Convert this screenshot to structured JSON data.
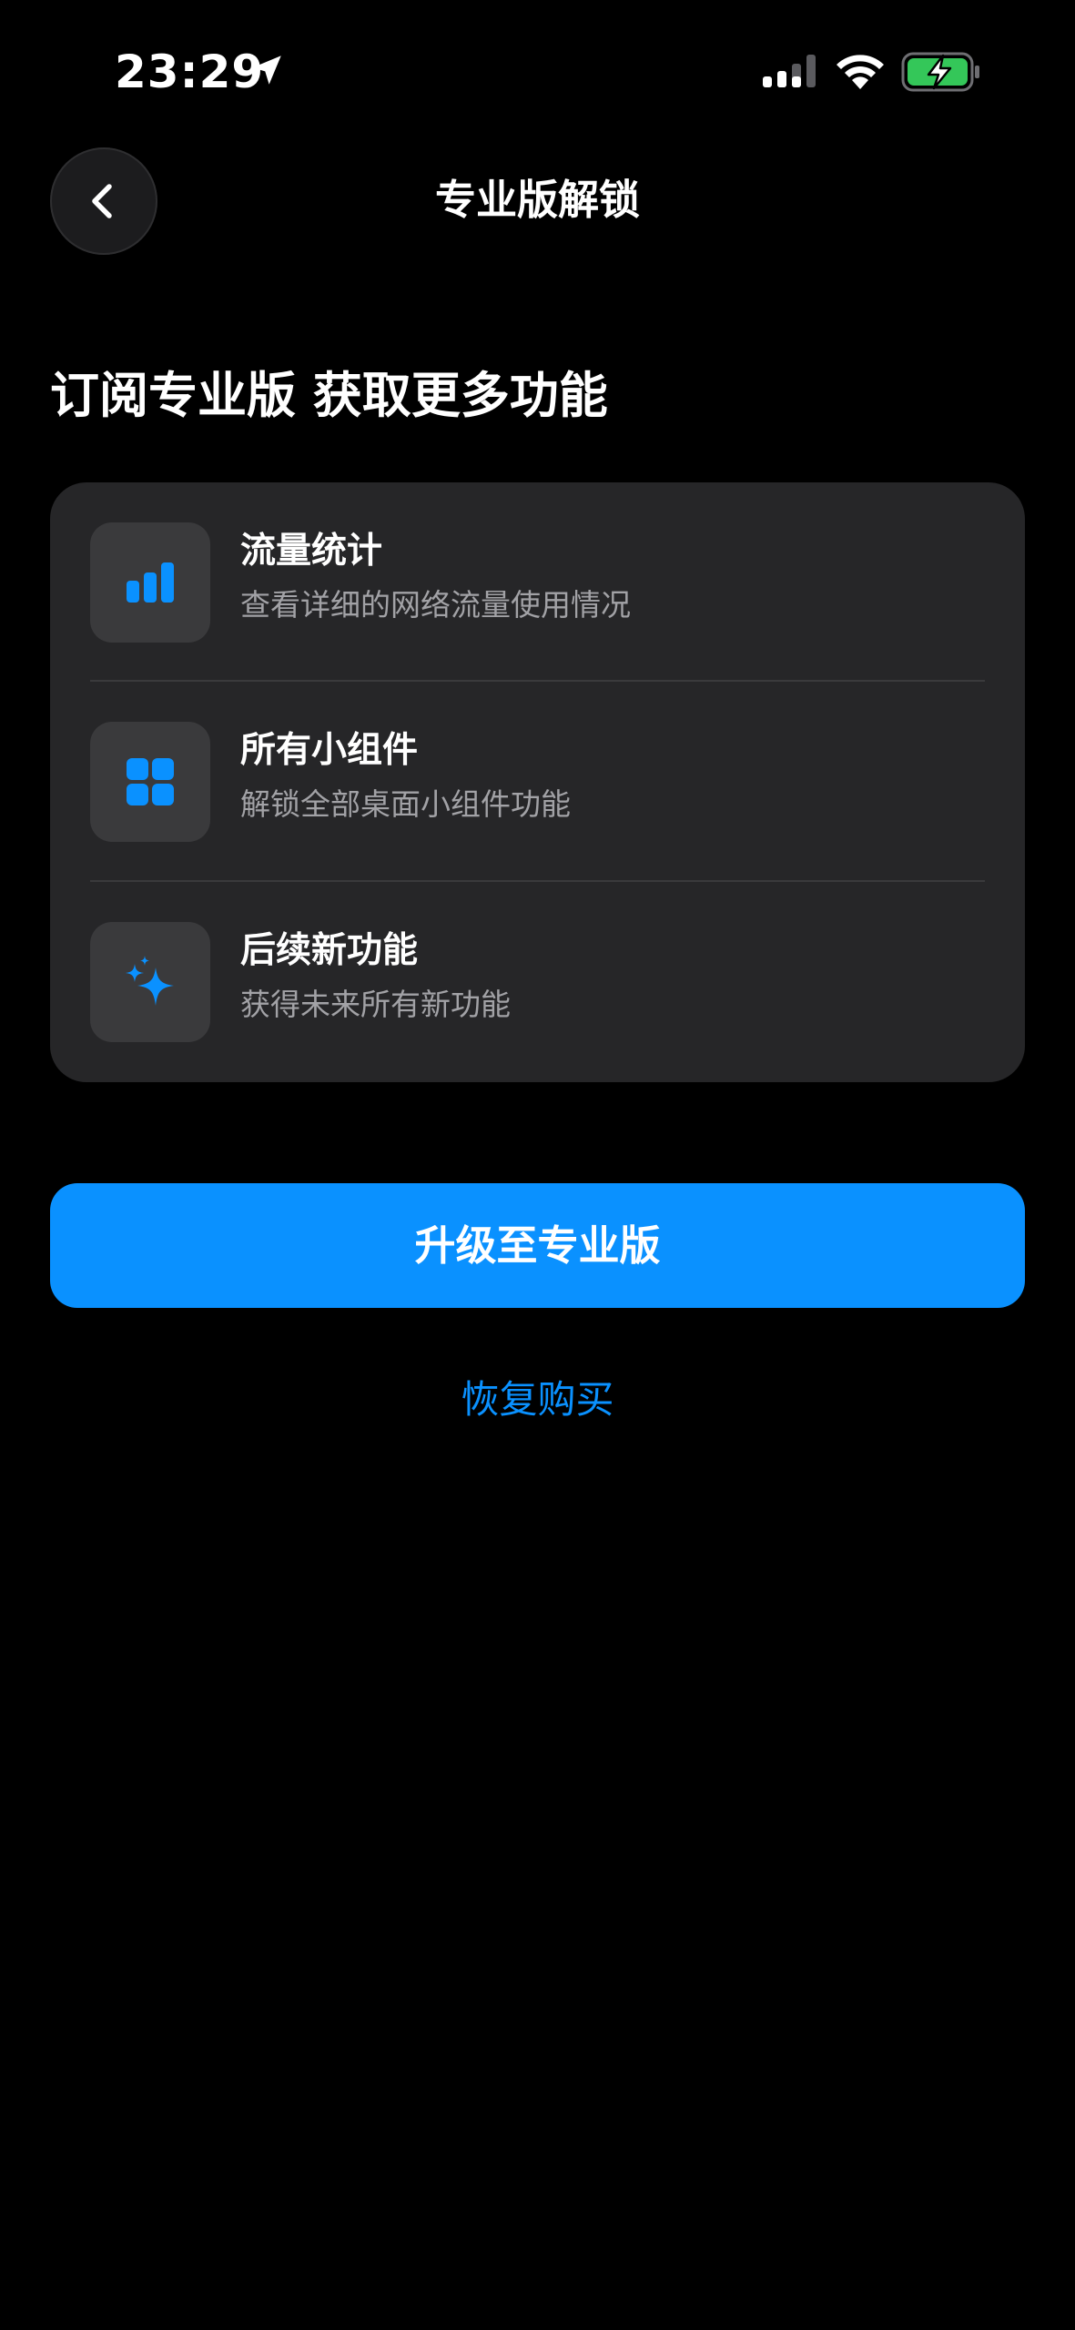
{
  "status_bar": {
    "time": "23:29",
    "icons": [
      "location-arrow-icon",
      "cellular-signal-icon",
      "wifi-icon",
      "battery-charging-icon"
    ]
  },
  "nav": {
    "title": "专业版解锁",
    "back_icon": "chevron-left-icon"
  },
  "heading": "订阅专业版 获取更多功能",
  "features": [
    {
      "icon": "bar-chart-icon",
      "title": "流量统计",
      "description": "查看详细的网络流量使用情况"
    },
    {
      "icon": "widgets-grid-icon",
      "title": "所有小组件",
      "description": "解锁全部桌面小组件功能"
    },
    {
      "icon": "sparkles-icon",
      "title": "后续新功能",
      "description": "获得未来所有新功能"
    }
  ],
  "upgrade_button_label": "升级至专业版",
  "restore_label": "恢复购买",
  "colors": {
    "accent": "#0A91FF",
    "background": "#000000",
    "card": "#262628",
    "icon_tile": "#3A3A3C",
    "secondary_text": "#A2A2A6",
    "battery_green": "#34C759"
  }
}
